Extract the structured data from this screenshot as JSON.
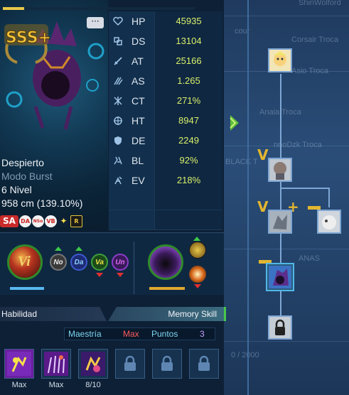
{
  "character": {
    "state": "Despierto",
    "mode": "Modo Burst",
    "level": "6 Nivel",
    "size": "958 cm (139.10%)",
    "rank": "SSS+",
    "chat_icon": "···"
  },
  "stats": [
    {
      "icon": "heart-icon",
      "label": "HP",
      "value": "45935"
    },
    {
      "icon": "ds-icon",
      "label": "DS",
      "value": "13104"
    },
    {
      "icon": "sword-icon",
      "label": "AT",
      "value": "25166"
    },
    {
      "icon": "speed-icon",
      "label": "AS",
      "value": "1.265"
    },
    {
      "icon": "critical-icon",
      "label": "CT",
      "value": "271%"
    },
    {
      "icon": "hit-icon",
      "label": "HT",
      "value": "8947"
    },
    {
      "icon": "shield-icon",
      "label": "DE",
      "value": "2249"
    },
    {
      "icon": "block-icon",
      "label": "BL",
      "value": "92%"
    },
    {
      "icon": "evade-icon",
      "label": "EV",
      "value": "218%"
    }
  ],
  "status_badges": [
    "SA",
    "DA",
    "NSo",
    "VB",
    "✦",
    "R"
  ],
  "evolution": {
    "main_orb": "Vi",
    "attributes": [
      "No",
      "Da",
      "Va",
      "Un"
    ]
  },
  "tabs": {
    "skill_tab": "Habilidad",
    "memory_tab": "Memory Skill"
  },
  "mastery": {
    "label": "Maestría",
    "value": "Max",
    "points_label": "Puntos",
    "points_value": "3"
  },
  "skills": [
    {
      "caption": "Max",
      "locked": false
    },
    {
      "caption": "Max",
      "locked": false
    },
    {
      "caption": "8/10",
      "locked": false
    },
    {
      "caption": "",
      "locked": true
    },
    {
      "caption": "",
      "locked": true
    },
    {
      "caption": "",
      "locked": true
    }
  ],
  "tree": {
    "plus": "+"
  },
  "background_text": [
    "ShinWolford",
    "cour",
    "Corsair Troca",
    "Asio Troca",
    "Anaia Troca",
    "nnoDzk Troca",
    "BLACK T",
    "ANAS",
    "0 / 2000"
  ],
  "colors": {
    "stat_value": "#d9f06a",
    "mode_text": "#7f9ab5",
    "accent_green": "#48c74a",
    "mastery_max": "#ff5a5a",
    "mastery_label": "#7fd3f0",
    "points_value": "#c99cff"
  }
}
